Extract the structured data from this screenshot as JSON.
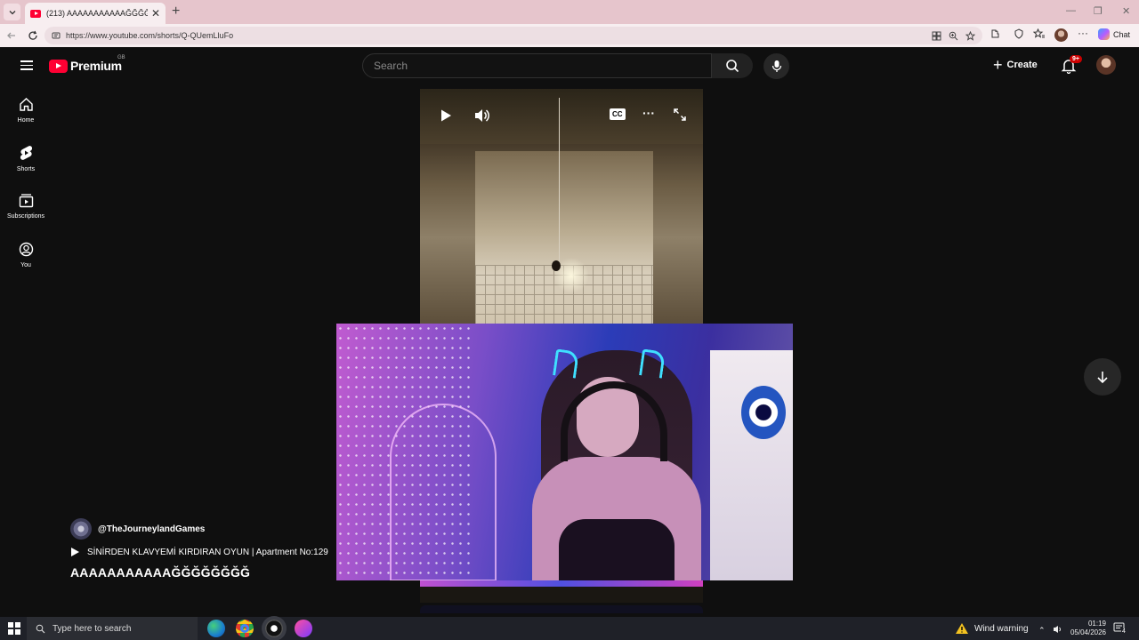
{
  "browser": {
    "tab_title": "(213) AAAAAAAAAAAĞĞĞĞĞĞĞĞ",
    "url": "https://www.youtube.com/shorts/Q-QUemLluFo",
    "chat_label": "Chat"
  },
  "header": {
    "logo_text": "Premium",
    "region": "GB",
    "search_placeholder": "Search",
    "create_label": "Create",
    "notification_badge": "9+"
  },
  "sidebar": {
    "items": [
      {
        "label": "Home",
        "icon": "home-icon"
      },
      {
        "label": "Shorts",
        "icon": "shorts-icon"
      },
      {
        "label": "Subscriptions",
        "icon": "subscriptions-icon"
      },
      {
        "label": "You",
        "icon": "you-icon"
      }
    ]
  },
  "video": {
    "channel": "@TheJourneylandGames",
    "playlist": "SİNİRDEN KLAVYEMİ KIRDIRAN OYUN | Apartment No:129",
    "title": "AAAAAAAAAAAĞĞĞĞĞĞĞĞ",
    "controls": [
      "play-icon",
      "volume-icon",
      "captions-icon",
      "more-icon",
      "fullscreen-icon"
    ],
    "captions_label": "CC"
  },
  "taskbar": {
    "search_placeholder": "Type here to search",
    "weather": "Wind warning",
    "time": "01:19",
    "date": "05/04/2026",
    "notification_count": "4"
  },
  "colors": {
    "youtube_red": "#ff0033",
    "page_bg": "#0f0f0f",
    "tabbar_bg": "#e6c5cc"
  }
}
